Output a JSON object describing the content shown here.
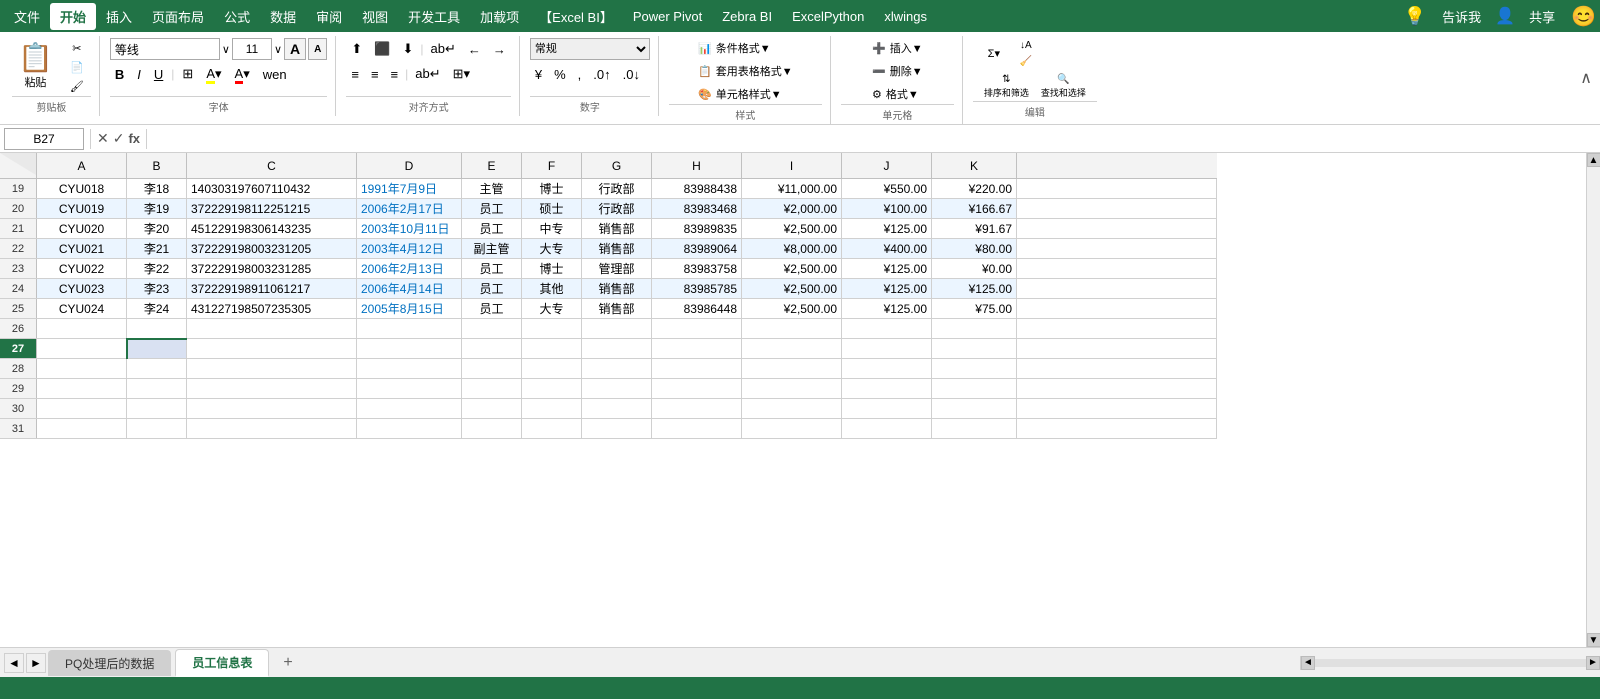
{
  "menu": {
    "items": [
      "文件",
      "开始",
      "插入",
      "页面布局",
      "公式",
      "数据",
      "审阅",
      "视图",
      "开发工具",
      "加载项",
      "【Excel BI】",
      "Power Pivot",
      "Zebra BI",
      "ExcelPython",
      "xlwings"
    ],
    "right_items": [
      "告诉我",
      "共享"
    ],
    "active": "开始"
  },
  "ribbon": {
    "clipboard_label": "剪贴板",
    "font_label": "字体",
    "alignment_label": "对齐方式",
    "number_label": "数字",
    "styles_label": "样式",
    "cells_label": "单元格",
    "editing_label": "编辑",
    "font_name": "等线",
    "font_size": "11",
    "bold": "B",
    "italic": "I",
    "underline": "U",
    "format_cells": "条件格式▼",
    "table_style": "套用表格格式▼",
    "cell_style": "单元格样式▼",
    "insert": "插入▼",
    "delete": "删除▼",
    "format": "格式▼",
    "sort_filter": "排序和筛选",
    "find_select": "查找和选择",
    "num_format": "常规"
  },
  "formula_bar": {
    "cell_ref": "B27",
    "formula": ""
  },
  "columns": {
    "letters": [
      "A",
      "B",
      "C",
      "D",
      "E",
      "F",
      "G",
      "H",
      "I",
      "J",
      "K"
    ],
    "widths": [
      90,
      60,
      170,
      105,
      60,
      60,
      70,
      90,
      100,
      90,
      85
    ]
  },
  "rows": {
    "numbers": [
      19,
      20,
      21,
      22,
      23,
      24,
      25,
      26,
      27,
      28,
      29,
      30,
      31
    ],
    "data": [
      [
        "CYU018",
        "李18",
        "140303197607110432",
        "1991年7月9日",
        "主管",
        "博士",
        "行政部",
        "83988438",
        "¥11,000.00",
        "¥550.00",
        "¥220.00"
      ],
      [
        "CYU019",
        "李19",
        "372229198112251215",
        "2006年2月17日",
        "员工",
        "硕士",
        "行政部",
        "83983468",
        "¥2,000.00",
        "¥100.00",
        "¥166.67"
      ],
      [
        "CYU020",
        "李20",
        "451229198306143235",
        "2003年10月11日",
        "员工",
        "中专",
        "销售部",
        "83989835",
        "¥2,500.00",
        "¥125.00",
        "¥91.67"
      ],
      [
        "CYU021",
        "李21",
        "372229198003231205",
        "2003年4月12日",
        "副主管",
        "大专",
        "销售部",
        "83989064",
        "¥8,000.00",
        "¥400.00",
        "¥80.00"
      ],
      [
        "CYU022",
        "李22",
        "372229198003231285",
        "2006年2月13日",
        "员工",
        "博士",
        "管理部",
        "83983758",
        "¥2,500.00",
        "¥125.00",
        "¥0.00"
      ],
      [
        "CYU023",
        "李23",
        "372229198911061217",
        "2006年4月14日",
        "员工",
        "其他",
        "销售部",
        "83985785",
        "¥2,500.00",
        "¥125.00",
        "¥125.00"
      ],
      [
        "CYU024",
        "李24",
        "431227198507235305",
        "2005年8月15日",
        "员工",
        "大专",
        "销售部",
        "83986448",
        "¥2,500.00",
        "¥125.00",
        "¥75.00"
      ],
      [
        "",
        "",
        "",
        "",
        "",
        "",
        "",
        "",
        "",
        "",
        ""
      ],
      [
        "",
        "",
        "",
        "",
        "",
        "",
        "",
        "",
        "",
        "",
        ""
      ],
      [
        "",
        "",
        "",
        "",
        "",
        "",
        "",
        "",
        "",
        "",
        ""
      ],
      [
        "",
        "",
        "",
        "",
        "",
        "",
        "",
        "",
        "",
        "",
        ""
      ],
      [
        "",
        "",
        "",
        "",
        "",
        "",
        "",
        "",
        "",
        "",
        ""
      ],
      [
        "",
        "",
        "",
        "",
        "",
        "",
        "",
        "",
        "",
        "",
        ""
      ]
    ],
    "date_col": 3,
    "blue_cols": [
      3
    ]
  },
  "sheets": [
    "PQ处理后的数据",
    "员工信息表"
  ],
  "active_sheet": "员工信息表",
  "status": {
    "left": "",
    "right": ""
  }
}
